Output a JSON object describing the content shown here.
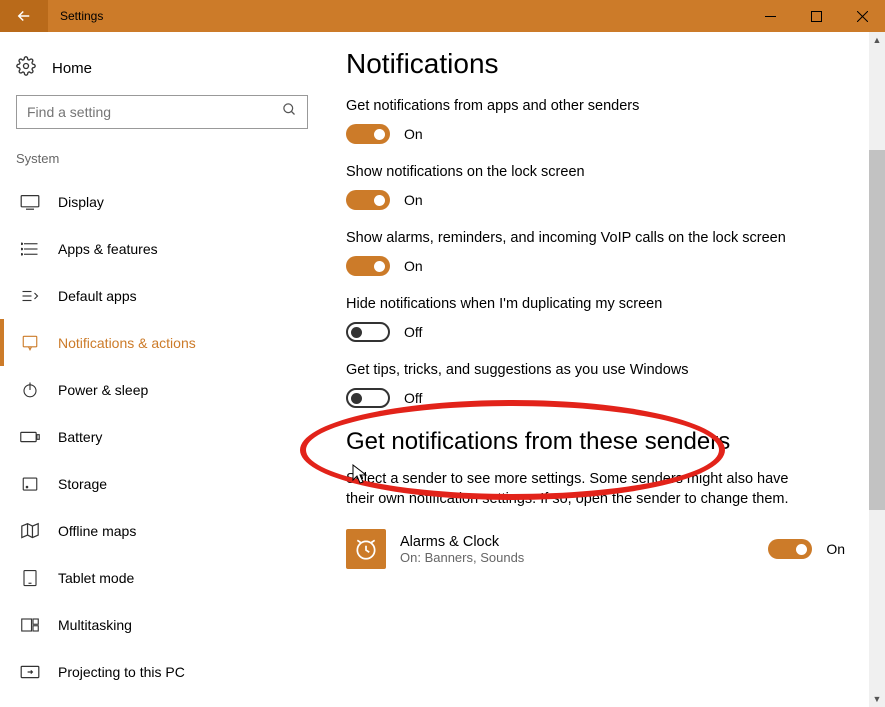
{
  "window": {
    "title": "Settings"
  },
  "sidebar": {
    "home": "Home",
    "search_placeholder": "Find a setting",
    "category": "System",
    "items": [
      {
        "label": "Display"
      },
      {
        "label": "Apps & features"
      },
      {
        "label": "Default apps"
      },
      {
        "label": "Notifications & actions"
      },
      {
        "label": "Power & sleep"
      },
      {
        "label": "Battery"
      },
      {
        "label": "Storage"
      },
      {
        "label": "Offline maps"
      },
      {
        "label": "Tablet mode"
      },
      {
        "label": "Multitasking"
      },
      {
        "label": "Projecting to this PC"
      }
    ]
  },
  "main": {
    "heading": "Notifications",
    "settings": [
      {
        "label": "Get notifications from apps and other senders",
        "state": "On",
        "on": true
      },
      {
        "label": "Show notifications on the lock screen",
        "state": "On",
        "on": true
      },
      {
        "label": "Show alarms, reminders, and incoming VoIP calls on the lock screen",
        "state": "On",
        "on": true
      },
      {
        "label": "Hide notifications when I'm duplicating my screen",
        "state": "Off",
        "on": false
      },
      {
        "label": "Get tips, tricks, and suggestions as you use Windows",
        "state": "Off",
        "on": false
      }
    ],
    "senders_heading": "Get notifications from these senders",
    "senders_desc": "Select a sender to see more settings. Some senders might also have their own notification settings. If so, open the sender to change them.",
    "senders": [
      {
        "name": "Alarms & Clock",
        "sub": "On: Banners, Sounds",
        "state": "On",
        "on": true
      }
    ]
  },
  "colors": {
    "accent": "#cc7b29"
  }
}
